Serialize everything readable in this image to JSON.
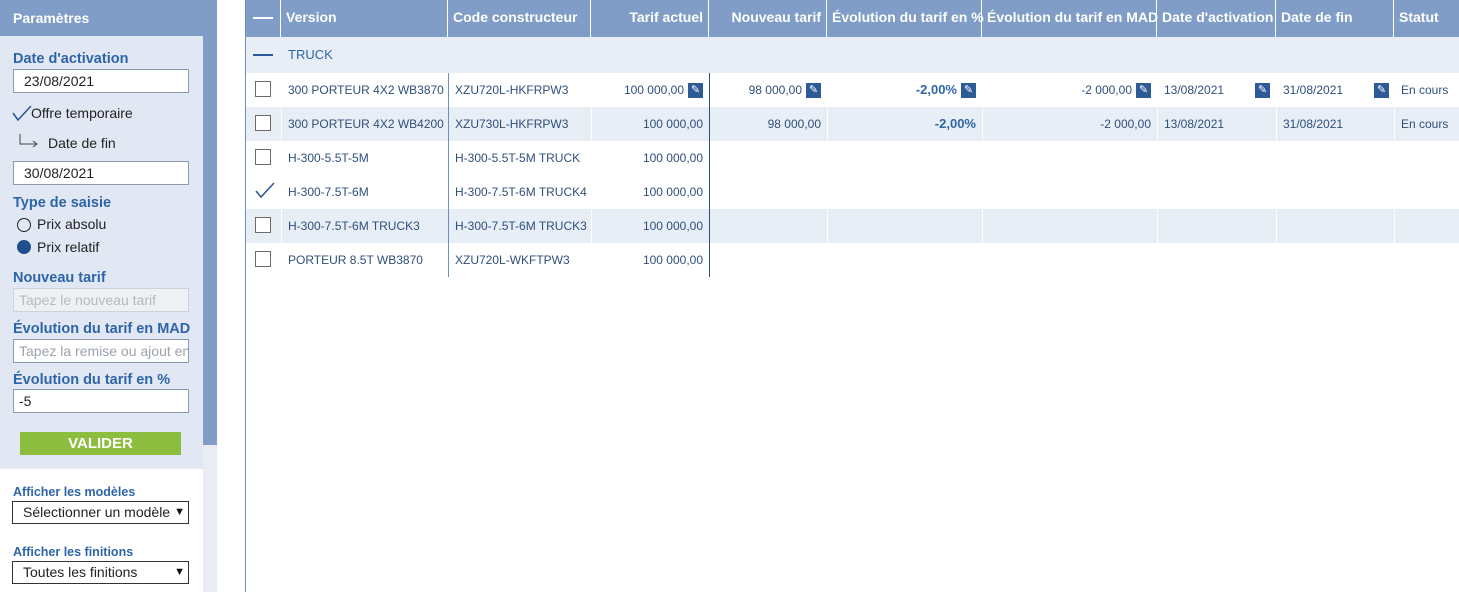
{
  "left": {
    "header": "Paramètres",
    "date_activation_label": "Date d'activation",
    "date_activation_value": "23/08/2021",
    "offre_temporaire_label": "Offre temporaire",
    "date_fin_label": "Date de fin",
    "date_fin_value": "30/08/2021",
    "type_saisie_label": "Type de saisie",
    "radio_absolu": "Prix absolu",
    "radio_relatif": "Prix relatif",
    "nouveau_tarif_label": "Nouveau tarif",
    "nouveau_tarif_placeholder": "Tapez le nouveau tarif",
    "evo_mad_label": "Évolution du tarif en MAD",
    "evo_mad_placeholder": "Tapez la remise ou ajout en",
    "evo_pct_label": "Évolution du tarif en %",
    "evo_pct_value": "-5",
    "valider": "VALIDER",
    "afficher_modeles_label": "Afficher les modèles",
    "modeles_selected": "Sélectionner un modèle",
    "afficher_finitions_label": "Afficher les finitions",
    "finitions_selected": "Toutes les finitions"
  },
  "grid": {
    "headers": {
      "version": "Version",
      "code": "Code constructeur",
      "tarif_actuel": "Tarif actuel",
      "nouveau_tarif": "Nouveau tarif",
      "evo_pct": "Évolution du tarif en %",
      "evo_mad": "Évolution du tarif en MAD",
      "date_activation": "Date d'activation",
      "date_fin": "Date de fin",
      "statut": "Statut"
    },
    "group": "TRUCK",
    "rows": [
      {
        "version": "300 PORTEUR 4X2 WB3870",
        "code": "XZU720L-HKFRPW3",
        "tarif": "100 000,00",
        "nouveau": "98 000,00",
        "pct": "-2,00%",
        "mad": "-2 000,00",
        "date_act": "13/08/2021",
        "date_fin": "31/08/2021",
        "statut": "En cours"
      },
      {
        "version": "300 PORTEUR 4X2 WB4200",
        "code": "XZU730L-HKFRPW3",
        "tarif": "100 000,00",
        "nouveau": "98 000,00",
        "pct": "-2,00%",
        "mad": "-2 000,00",
        "date_act": "13/08/2021",
        "date_fin": "31/08/2021",
        "statut": "En cours"
      },
      {
        "version": "H-300-5.5T-5M",
        "code": "H-300-5.5T-5M TRUCK",
        "tarif": "100 000,00"
      },
      {
        "version": "H-300-7.5T-6M",
        "code": "H-300-7.5T-6M TRUCK4",
        "tarif": "100 000,00"
      },
      {
        "version": "H-300-7.5T-6M TRUCK3",
        "code": "H-300-7.5T-6M TRUCK3",
        "tarif": "100 000,00"
      },
      {
        "version": "PORTEUR 8.5T WB3870",
        "code": "XZU720L-WKFTPW3",
        "tarif": "100 000,00"
      }
    ]
  }
}
